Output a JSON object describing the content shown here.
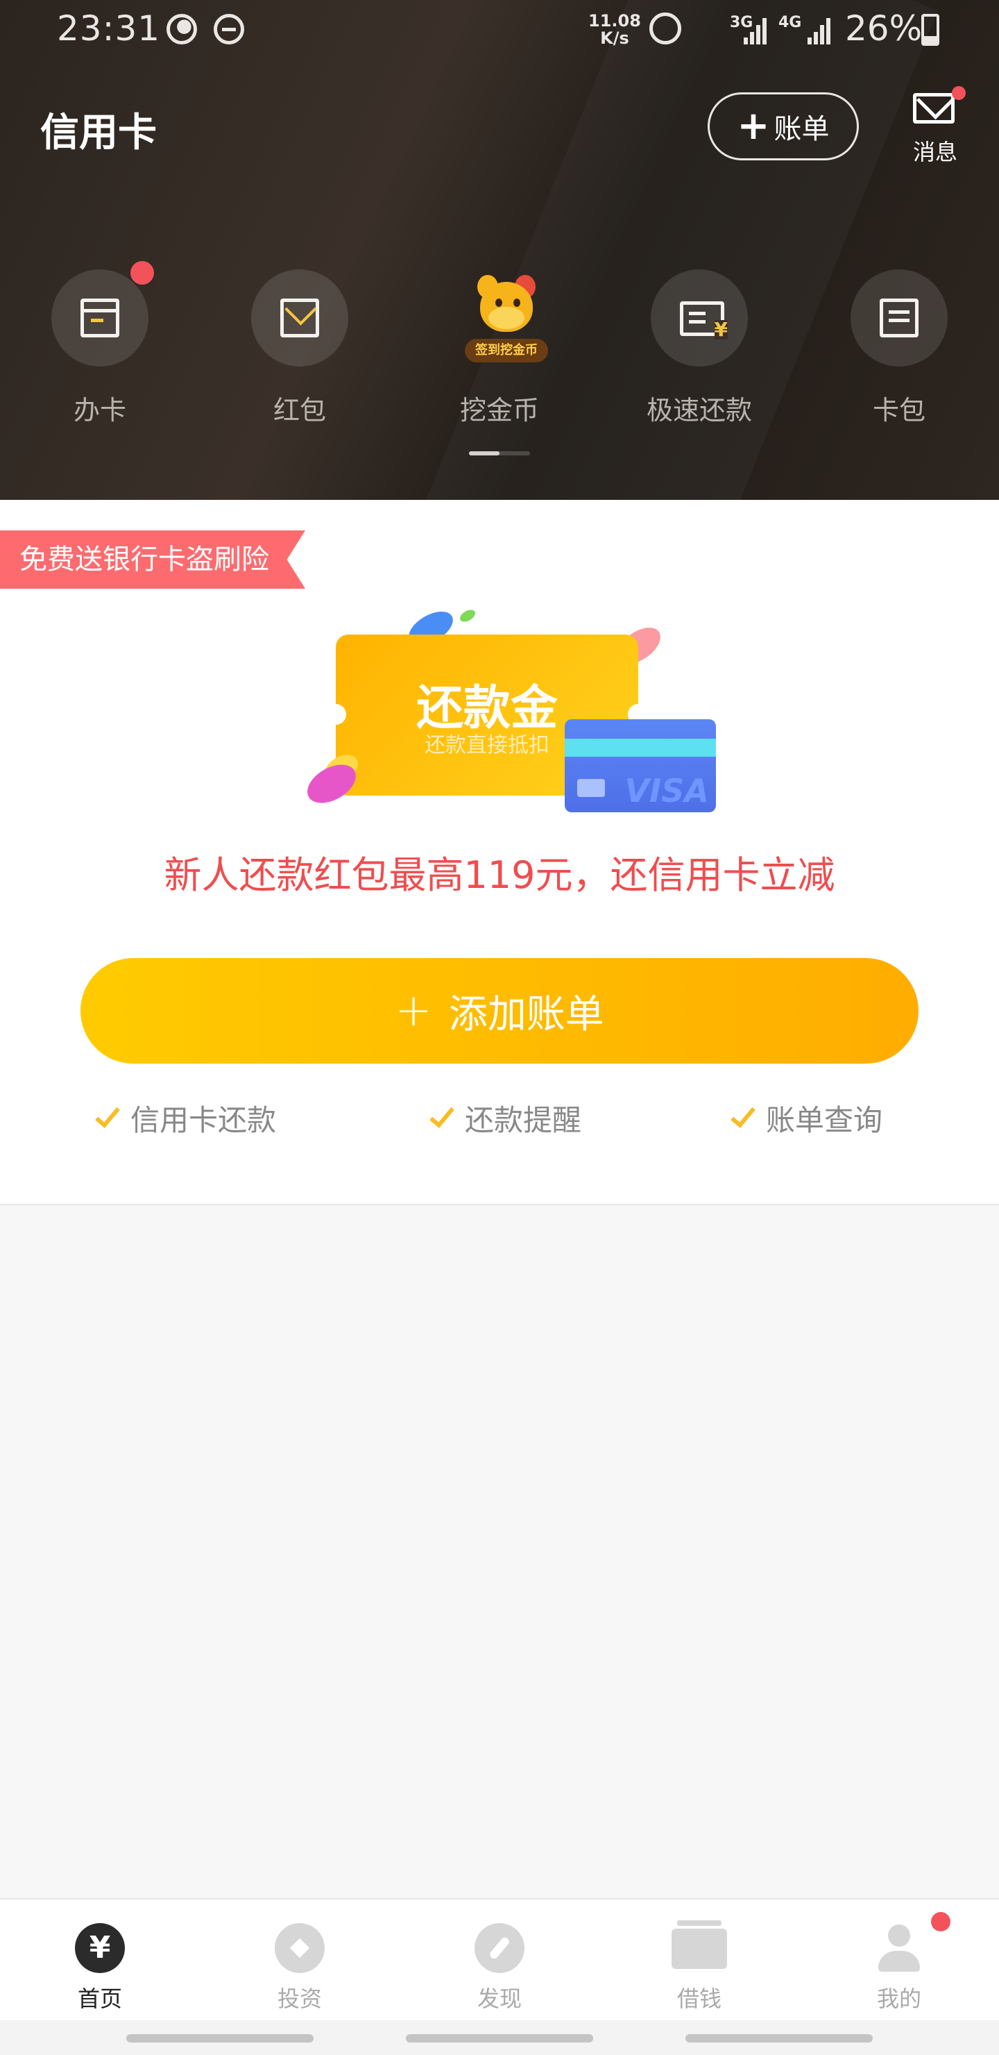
{
  "status_bar": {
    "time": "23:31",
    "speed_top": "11.08",
    "speed_bottom": "K/s",
    "net_3g": "3G",
    "net_4g": "4G",
    "battery": "26%"
  },
  "header": {
    "title": "信用卡",
    "add_bill_label": "账单",
    "messages_label": "消息"
  },
  "quick_actions": [
    {
      "label": "办卡",
      "icon": "card-icon",
      "badge": true
    },
    {
      "label": "红包",
      "icon": "red-packet-icon",
      "badge": false
    },
    {
      "label": "挖金币",
      "icon": "mascot-icon",
      "badge_text": "签到挖金币"
    },
    {
      "label": "极速还款",
      "icon": "fast-repay-icon",
      "badge": false
    },
    {
      "label": "卡包",
      "icon": "card-wallet-icon",
      "badge": false
    }
  ],
  "promo_card": {
    "ribbon": "免费送银行卡盗刷险",
    "ticket_title": "还款金",
    "ticket_subtitle": "还款直接抵扣",
    "card_brand": "VISA",
    "promo_text": "新人还款红包最高119元，还信用卡立减",
    "add_button_label": "添加账单",
    "features": [
      "信用卡还款",
      "还款提醒",
      "账单查询"
    ]
  },
  "tab_bar": [
    {
      "label": "首页",
      "icon": "yuan-icon",
      "icon_text": "¥",
      "active": true
    },
    {
      "label": "投资",
      "icon": "diamond-icon",
      "active": false
    },
    {
      "label": "发现",
      "icon": "compass-icon",
      "active": false
    },
    {
      "label": "借钱",
      "icon": "wallet-icon",
      "active": false
    },
    {
      "label": "我的",
      "icon": "person-icon",
      "active": false,
      "badge": true
    }
  ],
  "colors": {
    "accent_yellow": "#ffc000",
    "promo_red": "#ef4d4f",
    "badge_red": "#f4525b",
    "header_dark": "#2b241f"
  }
}
